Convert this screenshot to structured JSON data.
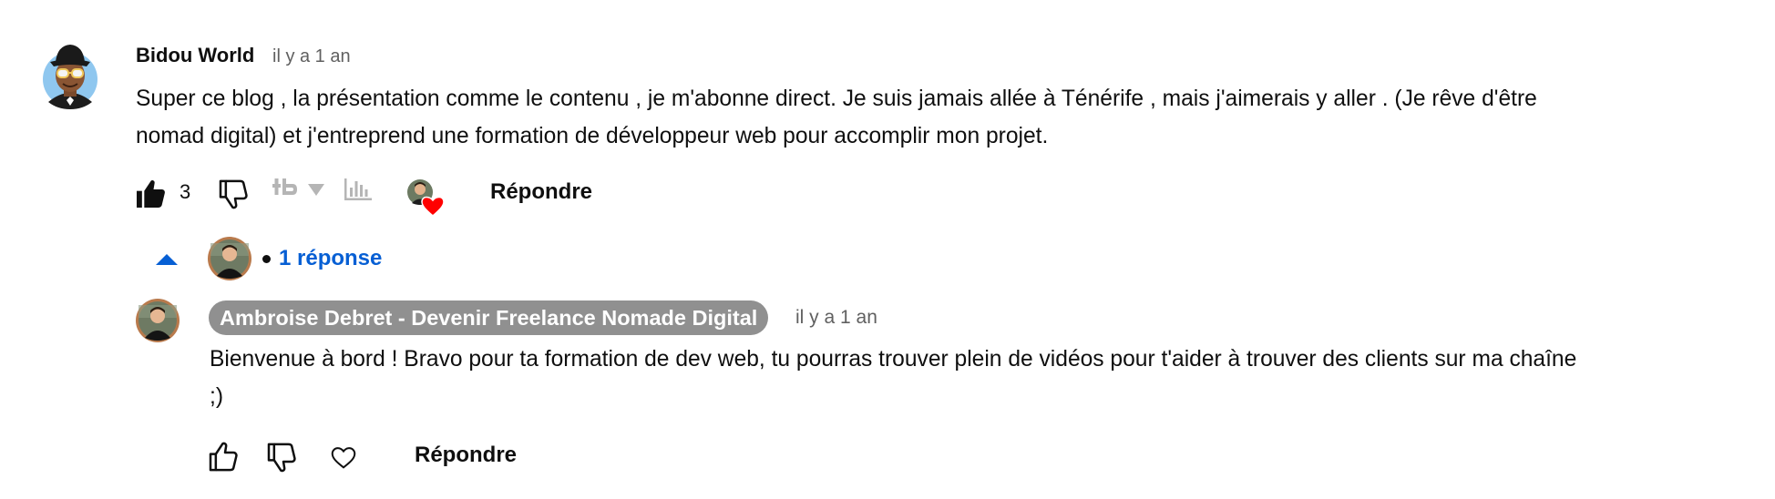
{
  "comment": {
    "author": "Bidou World",
    "timestamp": "il y a 1 an",
    "text_line1": "Super ce blog , la présentation comme le contenu , je m'abonne direct. Je suis jamais allée à Ténérife , mais j'aimerais y aller . (Je rêve d'être",
    "text_line2": "nomad digital) et j'entreprend une formation de développeur web pour accomplir mon projet.",
    "like_count": "3",
    "liked": true,
    "reply_label": "Répondre",
    "creator_heart": true,
    "icons": [
      "like-icon",
      "dislike-icon",
      "tubebuddy-icon",
      "dropdown-icon",
      "stats-icon",
      "creator-heart-icon"
    ]
  },
  "replies_toggle": {
    "expanded": true,
    "label": "1 réponse"
  },
  "reply": {
    "author": "Ambroise Debret - Devenir Freelance Nomade Digital",
    "timestamp": "il y a 1 an",
    "text_line1": "Bienvenue à bord ! Bravo pour ta formation de dev web, tu pourras trouver plein de vidéos pour t'aider à trouver des clients sur ma chaîne",
    "text_line2": ";)",
    "reply_label": "Répondre",
    "icons": [
      "like-icon",
      "dislike-icon",
      "heart-icon"
    ]
  },
  "colors": {
    "text": "#0f0f0f",
    "secondary": "#606060",
    "link_blue": "#065fd4",
    "author_pill": "#909090",
    "heart_red": "#ff0000"
  }
}
